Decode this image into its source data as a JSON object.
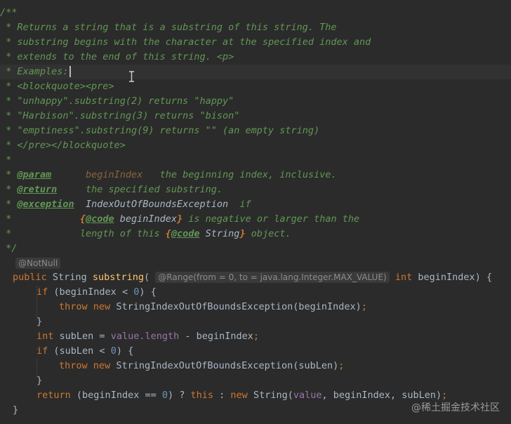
{
  "editor": {
    "cursor_icon": "text-cursor-icon",
    "colors": {
      "background": "#2b2b2b",
      "doc_comment": "#629755",
      "keyword": "#cc7832",
      "method": "#ffc66d",
      "number": "#6897bb",
      "field": "#9876aa",
      "text": "#a9b7c6"
    },
    "doc": {
      "open": "/**",
      "star": " * ",
      "star_only": " *",
      "close": " */",
      "line1": "Returns a string that is a substring of this string. The",
      "line2": "substring begins with the character at the specified index and",
      "line3": "extends to the end of this string. <p>",
      "line4": "Examples:",
      "line5": "<blockquote><pre>",
      "line6": "\"unhappy\".substring(2) returns \"happy\"",
      "line7": "\"Harbison\".substring(3) returns \"bison\"",
      "line8": "\"emptiness\".substring(9) returns \"\" (an empty string)",
      "line9": "</pre></blockquote>",
      "param_tag": "@param",
      "param_name": "beginIndex",
      "param_desc": "the beginning index, inclusive.",
      "return_tag": "@return",
      "return_desc": "the specified substring.",
      "exception_tag": "@exception",
      "exception_name": "IndexOutOfBoundsException",
      "exception_if": "if",
      "code_tag": "@code",
      "lbrace": "{",
      "rbrace": "}",
      "exc_line2_ref": "beginIndex",
      "exc_line2_text": "is negative or larger than the",
      "exc_line3_text": "length of this",
      "exc_line3_ref": "String",
      "exc_line3_end": "object."
    },
    "hints": {
      "notnull": "@NotNull",
      "range": "@Range(from = 0, to = java.lang.Integer.MAX_VALUE)"
    },
    "code": {
      "public": "public",
      "string_type": "String",
      "method": "substring",
      "paren_open": "(",
      "int": "int",
      "param": "beginIndex",
      "sig_end": ") {",
      "if": "if",
      "cond1_a": "(beginIndex < ",
      "zero": "0",
      "cond_end": ") {",
      "throw": "throw",
      "new": "new",
      "exception_call1": "StringIndexOutOfBoundsException(beginIndex)",
      "semicolon": ";",
      "close_brace": "}",
      "sublen_decl": "subLen = ",
      "value": "value",
      "length_expr": ".length",
      "minus_begin": " - beginIndex",
      "cond2_a": "(subLen < ",
      "exception_call2": "StringIndexOutOfBoundsException(subLen)",
      "return": "return",
      "ret_a": "(beginIndex == ",
      "ret_b": ") ? ",
      "this": "this",
      "ret_c": " : ",
      "ret_call_a": "String(",
      "ret_call_b": ", beginIndex, subLen)",
      "end_brace": "}"
    }
  },
  "watermark": "@稀土掘金技术社区"
}
